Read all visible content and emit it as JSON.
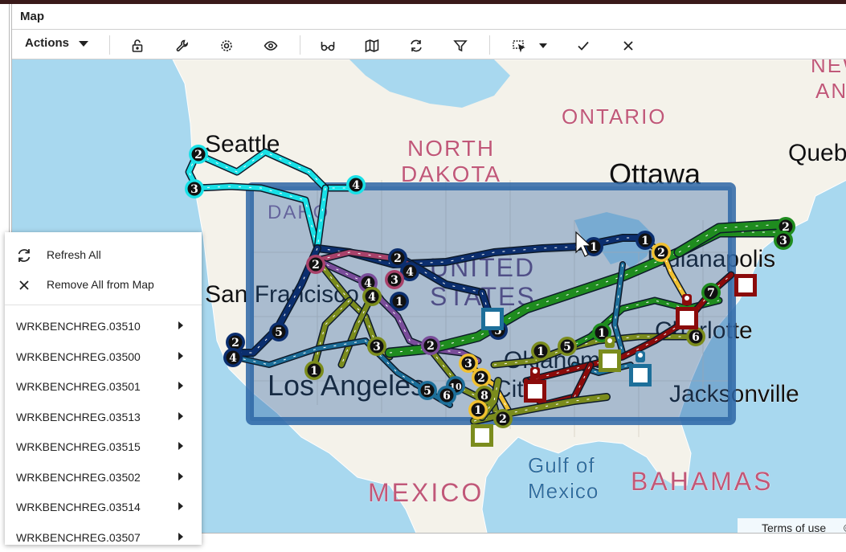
{
  "window": {
    "title": "Map"
  },
  "toolbar": {
    "actions_label": "Actions",
    "buttons": [
      {
        "icon": "unlock-icon"
      },
      {
        "icon": "wrench-icon"
      },
      {
        "icon": "gear-icon"
      },
      {
        "icon": "eye-icon"
      },
      {
        "icon": "glasses-icon"
      },
      {
        "icon": "map-icon"
      },
      {
        "icon": "refresh-icon"
      },
      {
        "icon": "filter-icon"
      },
      {
        "icon": "selection-icon"
      },
      {
        "icon": "chevron-down-icon"
      },
      {
        "icon": "check-icon"
      },
      {
        "icon": "close-icon"
      }
    ]
  },
  "map": {
    "labels": {
      "seattle": "Seattle",
      "north": "NORTH",
      "dakota": "DAKOTA",
      "ottawa": "Ottawa",
      "ontario": "ONTARIO",
      "quebec": "Queb",
      "new": "NEW",
      "an": "AN",
      "idaho": "DAHO",
      "united": "UNITED",
      "states": "STATES",
      "san_francisco": "San Francisco",
      "los_angeles": "Los Angeles",
      "oklahoma": "Oklahoma",
      "city": "City",
      "charlotte": "Charlotte",
      "indianapolis": "Indianapolis",
      "jacksonville": "Jacksonville",
      "gulf": "Gulf of",
      "mexico_gulf": "Mexico",
      "mexico": "MEXICO",
      "bahamas": "BAHAMAS"
    },
    "terms": "Terms of use",
    "copyright": "©",
    "colors": {
      "water": "#a8d8ef",
      "land": "#f5f3ec",
      "selection": "#2f5f9a",
      "route_cyan": "#19e0e6",
      "route_green": "#1f8c1f",
      "route_navy": "#0b2e6e",
      "route_olive": "#7b8c1d",
      "route_darkred": "#8b0b0b",
      "route_purple": "#7a4d9a",
      "route_teal": "#1d6f9a",
      "route_magenta": "#a8426a",
      "route_gold": "#f0c030"
    },
    "markers": [
      {
        "n": "2",
        "color": "#19e0e6"
      },
      {
        "n": "3",
        "color": "#19e0e6"
      },
      {
        "n": "4",
        "color": "#19e0e6"
      },
      {
        "n": "2",
        "color": "#a8426a"
      },
      {
        "n": "2",
        "color": "#0b2e6e"
      },
      {
        "n": "4",
        "color": "#0b2e6e"
      },
      {
        "n": "3",
        "color": "#a8426a"
      },
      {
        "n": "4",
        "color": "#7a4d9a"
      },
      {
        "n": "4",
        "color": "#7b8c1d"
      },
      {
        "n": "1",
        "color": "#0b2e6e"
      },
      {
        "n": "5",
        "color": "#0b2e6e"
      },
      {
        "n": "2",
        "color": "#0b2e6e"
      },
      {
        "n": "4",
        "color": "#0b2e6e"
      },
      {
        "n": "1",
        "color": "#7b8c1d"
      },
      {
        "n": "3",
        "color": "#7b8c1d"
      },
      {
        "n": "2",
        "color": "#7a4d9a"
      },
      {
        "n": "3",
        "color": "#f0c030"
      },
      {
        "n": "2",
        "color": "#f0c030"
      },
      {
        "n": "10",
        "color": "#1d6f9a"
      },
      {
        "n": "5",
        "color": "#1d6f9a"
      },
      {
        "n": "6",
        "color": "#1d6f9a"
      },
      {
        "n": "8",
        "color": "#7b8c1d"
      },
      {
        "n": "1",
        "color": "#f0c030"
      },
      {
        "n": "2",
        "color": "#7b8c1d"
      },
      {
        "n": "5",
        "color": "#0b2e6e"
      },
      {
        "n": "1",
        "color": "#7b8c1d"
      },
      {
        "n": "5",
        "color": "#7b8c1d"
      },
      {
        "n": "1",
        "color": "#1f8c1f"
      },
      {
        "n": "1",
        "color": "#0b2e6e"
      },
      {
        "n": "1",
        "color": "#0b2e6e"
      },
      {
        "n": "2",
        "color": "#f0c030"
      },
      {
        "n": "6",
        "color": "#7b8c1d"
      },
      {
        "n": "7",
        "color": "#1f8c1f"
      },
      {
        "n": "2",
        "color": "#1f8c1f"
      },
      {
        "n": "3",
        "color": "#1f8c1f"
      }
    ]
  },
  "context_menu": {
    "actions": [
      {
        "label": "Refresh All",
        "icon": "refresh-icon"
      },
      {
        "label": "Remove All from Map",
        "icon": "close-icon"
      }
    ],
    "items": [
      "WRKBENCHREG.03510",
      "WRKBENCHREG.03500",
      "WRKBENCHREG.03501",
      "WRKBENCHREG.03513",
      "WRKBENCHREG.03515",
      "WRKBENCHREG.03502",
      "WRKBENCHREG.03514",
      "WRKBENCHREG.03507"
    ]
  }
}
